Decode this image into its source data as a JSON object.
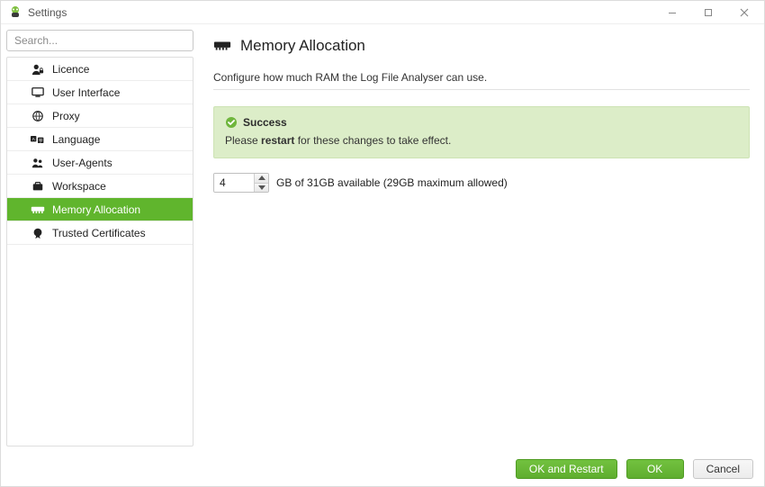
{
  "window": {
    "title": "Settings"
  },
  "search": {
    "placeholder": "Search..."
  },
  "sidebar": {
    "items": [
      {
        "label": "Licence",
        "icon": "user-lock-icon",
        "active": false
      },
      {
        "label": "User Interface",
        "icon": "monitor-icon",
        "active": false
      },
      {
        "label": "Proxy",
        "icon": "globe-icon",
        "active": false
      },
      {
        "label": "Language",
        "icon": "language-icon",
        "active": false
      },
      {
        "label": "User-Agents",
        "icon": "users-icon",
        "active": false
      },
      {
        "label": "Workspace",
        "icon": "briefcase-icon",
        "active": false
      },
      {
        "label": "Memory Allocation",
        "icon": "memory-icon",
        "active": true
      },
      {
        "label": "Trusted Certificates",
        "icon": "certificate-icon",
        "active": false
      }
    ]
  },
  "page": {
    "title": "Memory Allocation",
    "description": "Configure how much RAM the Log File Analyser can use."
  },
  "alert": {
    "title": "Success",
    "body_prefix": "Please ",
    "body_bold": "restart",
    "body_suffix": " for these changes to take effect."
  },
  "memory": {
    "value": "4",
    "suffix": "GB of 31GB available (29GB maximum allowed)"
  },
  "footer": {
    "ok_and_restart": "OK and Restart",
    "ok": "OK",
    "cancel": "Cancel"
  }
}
